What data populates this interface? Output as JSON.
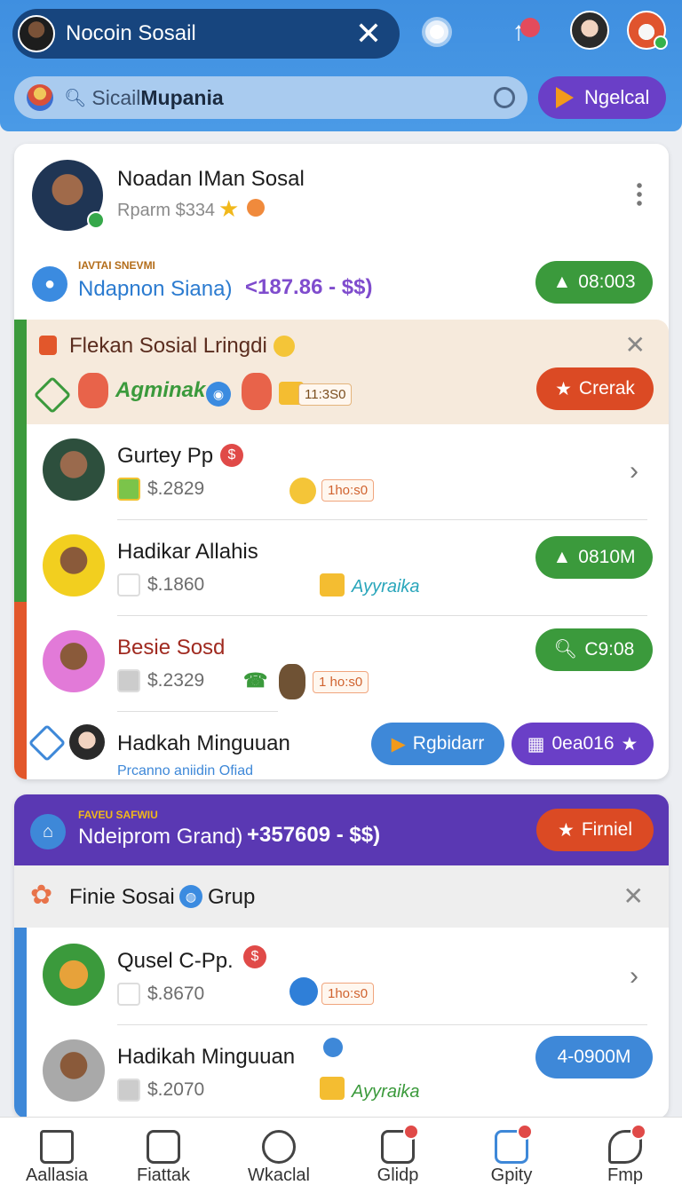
{
  "header": {
    "account_name": "Nocoin Sosail",
    "search_text_normal": "Sicail",
    "search_text_bold": "Mupania",
    "go_button": "Ngelcal"
  },
  "featured": {
    "name": "Noadan IMan Sosal",
    "sub": "Rparm $334",
    "stat_tiny": "IAVTAI SNEVMI",
    "stat_link": "Ndapnon Siana)",
    "stat_amount": "<187.86 - $$)",
    "pill": "08:003"
  },
  "group1": {
    "title": "Flekan Sosial Lringdi",
    "script": "Agminak",
    "tag": "11:3S0",
    "button": "Crerak",
    "rows": [
      {
        "name": "Gurtey Pp",
        "price": "$.2829",
        "tag": "1ho:s0",
        "action": "chevron"
      },
      {
        "name": "Hadikar Allahis",
        "price": "$.1860",
        "script": "Ayyraika",
        "pill": "0810M"
      },
      {
        "name": "Besie Sosd",
        "price": "$.2329",
        "tag": "1 ho:s0",
        "pill": "C9:08"
      }
    ],
    "footer_name": "Hadkah Minguuan",
    "footer_sub": "Prcanno aniidin Ofiad",
    "footer_btn1": "Rgbidarr",
    "footer_btn2": "0ea016"
  },
  "featured2": {
    "stat_tiny": "FAVEU SAFWIU",
    "stat_link": "Ndeiprom Grand)",
    "stat_amount": "+357609 - $$)",
    "button": "Firniel"
  },
  "group2": {
    "title_a": "Finie Sosai",
    "title_b": "Grup",
    "rows": [
      {
        "name": "Qusel C-Pp.",
        "price": "$.8670",
        "tag": "1ho:s0"
      },
      {
        "name": "Hadikah Minguuan",
        "price": "$.2070",
        "script": "Ayyraika",
        "pill": "4-0900M"
      }
    ]
  },
  "nav": [
    {
      "label": "Aallasia",
      "icon": "home-icon"
    },
    {
      "label": "Fiattak",
      "icon": "list-icon"
    },
    {
      "label": "Wkaclal",
      "icon": "heart-icon"
    },
    {
      "label": "Glidp",
      "icon": "camera-icon"
    },
    {
      "label": "Gpity",
      "icon": "calendar-icon"
    },
    {
      "label": "Fmp",
      "icon": "leaf-icon"
    }
  ],
  "colors": {
    "primary": "#3f8fe0",
    "purple": "#6a3fc7",
    "green": "#3b9a3c",
    "red": "#db4a24"
  }
}
